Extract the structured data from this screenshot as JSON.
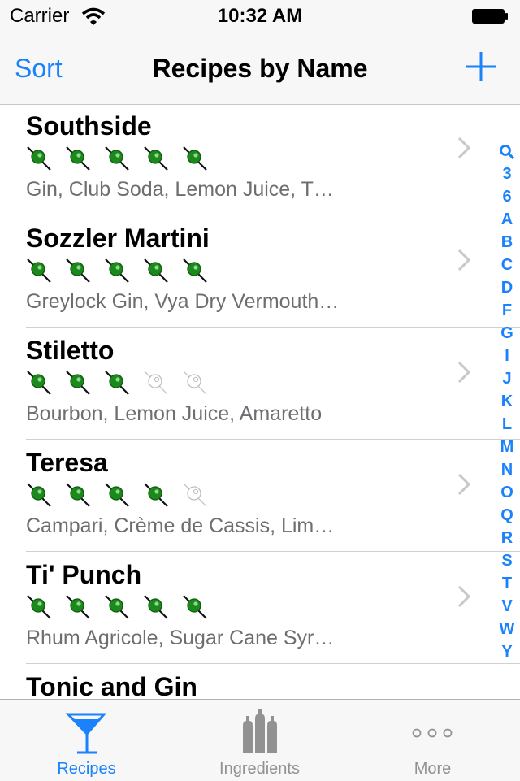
{
  "status_bar": {
    "carrier": "Carrier",
    "time": "10:32 AM"
  },
  "nav": {
    "sort_label": "Sort",
    "title": "Recipes by Name",
    "add_icon": "plus-icon"
  },
  "recipes": [
    {
      "name": "Southside",
      "rating": 5,
      "ingredients": "Gin, Club Soda, Lemon Juice, T…"
    },
    {
      "name": "Sozzler Martini",
      "rating": 5,
      "ingredients": "Greylock Gin, Vya Dry Vermouth…"
    },
    {
      "name": "Stiletto",
      "rating": 3,
      "ingredients": "Bourbon, Lemon Juice, Amaretto"
    },
    {
      "name": "Teresa",
      "rating": 4,
      "ingredients": "Campari, Crème de Cassis, Lim…"
    },
    {
      "name": "Ti' Punch",
      "rating": 5,
      "ingredients": "Rhum Agricole, Sugar Cane Syr…"
    },
    {
      "name": "Tonic and Gin",
      "rating": 0,
      "ingredients": ""
    }
  ],
  "rating_max": 5,
  "index_letters": [
    "search-icon",
    "3",
    "6",
    "A",
    "B",
    "C",
    "D",
    "F",
    "G",
    "I",
    "J",
    "K",
    "L",
    "M",
    "N",
    "O",
    "Q",
    "R",
    "S",
    "T",
    "V",
    "W",
    "Y"
  ],
  "tabs": [
    {
      "label": "Recipes",
      "icon": "cocktail-glass-icon",
      "selected": true
    },
    {
      "label": "Ingredients",
      "icon": "bottles-icon",
      "selected": false
    },
    {
      "label": "More",
      "icon": "more-dots-icon",
      "selected": false
    }
  ],
  "colors": {
    "accent": "#1a82fb",
    "olive_green": "#1a8a1a",
    "tab_inactive": "#929292"
  }
}
